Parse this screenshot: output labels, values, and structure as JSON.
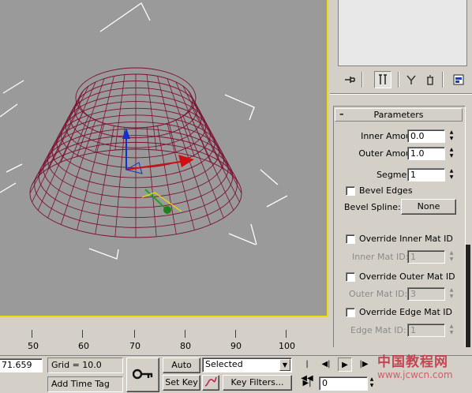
{
  "panel": {
    "rollout_title": "Parameters",
    "collapse_symbol": "–",
    "inner_amount_label": "Inner Amount:",
    "inner_amount_value": "0.0",
    "outer_amount_label": "Outer Amount:",
    "outer_amount_value": "1.0",
    "segments_label": "Segments:",
    "segments_value": "1",
    "bevel_edges_label": "Bevel Edges",
    "bevel_spline_label": "Bevel Spline:",
    "bevel_spline_button": "None",
    "override_inner_label": "Override Inner Mat ID",
    "inner_mat_id_label": "Inner Mat ID:",
    "inner_mat_id_value": "1",
    "override_outer_label": "Override Outer Mat ID",
    "outer_mat_id_label": "Outer Mat ID:",
    "outer_mat_id_value": "3",
    "override_edge_label": "Override Edge Mat ID",
    "edge_mat_id_label": "Edge Mat ID:",
    "edge_mat_id_value": "1"
  },
  "toolbar_icons": [
    "pin-stack-icon",
    "show-end-result-icon",
    "make-unique-icon",
    "remove-modifier-icon",
    "configure-modifier-sets-icon"
  ],
  "ruler": {
    "ticks": [
      "50",
      "60",
      "70",
      "80",
      "90",
      "100"
    ]
  },
  "status": {
    "coord_value": "71.659",
    "grid_label": "Grid = 10.0",
    "add_time_tag": "Add Time Tag",
    "auto_key": "Auto Key",
    "set_key": "Set Key",
    "selected_value": "Selected",
    "key_filters": "Key Filters...",
    "frame_value": "0"
  },
  "watermark": {
    "text": "中国教程网",
    "url": "www.jcwcn.com"
  },
  "colors": {
    "viewport_bg": "#9a9a9a",
    "active_border": "#f0e000",
    "mesh": "#7a1030",
    "panel_bg": "#d4d0c8"
  }
}
